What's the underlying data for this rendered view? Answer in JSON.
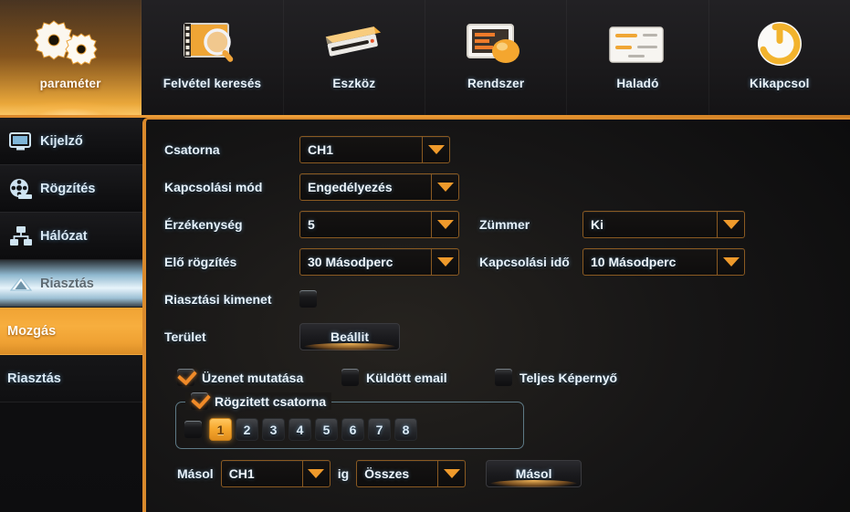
{
  "topbar": {
    "tabs": [
      {
        "label": "paraméter",
        "icon": "gears-icon",
        "active": true
      },
      {
        "label": "Felvétel keresés",
        "icon": "film-search-icon",
        "active": false
      },
      {
        "label": "Eszköz",
        "icon": "hard-disk-icon",
        "active": false
      },
      {
        "label": "Rendszer",
        "icon": "monitor-info-icon",
        "active": false
      },
      {
        "label": "Haladó",
        "icon": "list-panel-icon",
        "active": false
      },
      {
        "label": "Kikapcsol",
        "icon": "power-icon",
        "active": false
      }
    ]
  },
  "sidebar": {
    "items": [
      {
        "label": "Kijelző",
        "icon": "monitor-icon",
        "selected": false
      },
      {
        "label": "Rögzítés",
        "icon": "film-reel-icon",
        "selected": false
      },
      {
        "label": "Hálózat",
        "icon": "network-icon",
        "selected": false
      },
      {
        "label": "Riasztás",
        "icon": "alarm-shield-icon",
        "selected": true
      }
    ],
    "subitems": [
      {
        "label": "Mozgás",
        "active": true
      },
      {
        "label": "Riasztás",
        "active": false
      }
    ]
  },
  "form": {
    "channel": {
      "label": "Csatorna",
      "value": "CH1"
    },
    "switch_mode": {
      "label": "Kapcsolási mód",
      "value": "Engedélyezés"
    },
    "sensitivity": {
      "label": "Érzékenység",
      "value": "5"
    },
    "buzzer": {
      "label": "Zümmer",
      "value": "Ki"
    },
    "pre_record": {
      "label": "Elő rögzítés",
      "value": "30 Másodperc"
    },
    "switch_time": {
      "label": "Kapcsolási idő",
      "value": "10 Másodperc"
    },
    "alarm_output": {
      "label": "Riasztási kimenet",
      "checked": false
    },
    "area": {
      "label": "Terület",
      "button": "Beállit"
    },
    "show_message": {
      "label": "Üzenet mutatása",
      "checked": true
    },
    "send_email": {
      "label": "Küldött email",
      "checked": false
    },
    "full_screen": {
      "label": "Teljes Képernyő",
      "checked": false
    },
    "record_channel": {
      "label": "Rögzitett csatorna",
      "checked": true,
      "master_checked": false,
      "channels": [
        {
          "label": "1",
          "selected": true
        },
        {
          "label": "2",
          "selected": false
        },
        {
          "label": "3",
          "selected": false
        },
        {
          "label": "4",
          "selected": false
        },
        {
          "label": "5",
          "selected": false
        },
        {
          "label": "6",
          "selected": false
        },
        {
          "label": "7",
          "selected": false
        },
        {
          "label": "8",
          "selected": false
        }
      ]
    },
    "copy": {
      "label": "Másol",
      "from_value": "CH1",
      "to_label": "ig",
      "to_value": "Összes",
      "button": "Másol"
    }
  },
  "colors": {
    "accent_orange": "#ef9a2b",
    "accent_orange_bright": "#f7ae3e",
    "text_blue": "#e6f1fa",
    "panel_bg": "#171616",
    "group_border": "#5e7a86"
  }
}
